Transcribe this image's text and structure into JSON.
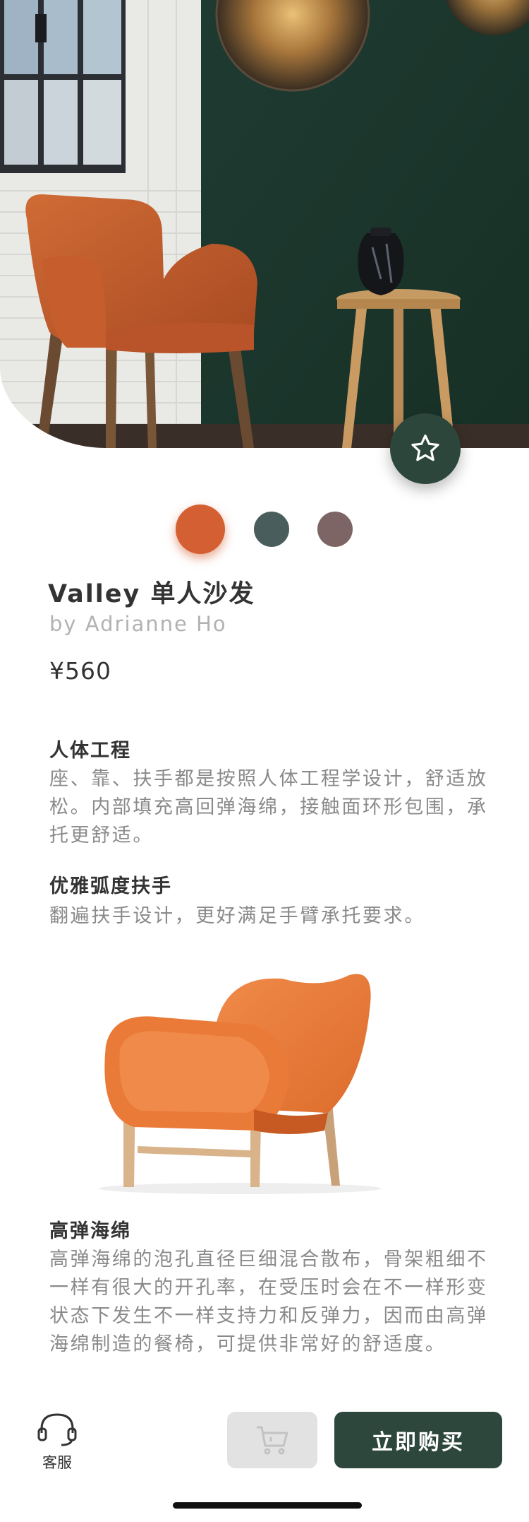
{
  "product": {
    "title": "Valley 单人沙发",
    "author": "by Adrianne Ho",
    "price": "¥560"
  },
  "colors": {
    "options": [
      "#d45f32",
      "#4a5d5d",
      "#7d6565"
    ],
    "selected_index": 0,
    "accent": "#2c463c"
  },
  "features": [
    {
      "title": "人体工程",
      "text": "座、靠、扶手都是按照人体工程学设计，舒适放松。内部填充高回弹海绵，接触面环形包围，承托更舒适。"
    },
    {
      "title": "优雅弧度扶手",
      "text": "翻遍扶手设计，更好满足手臂承托要求。"
    },
    {
      "title": "高弹海绵",
      "text": "高弹海绵的泡孔直径巨细混合散布，骨架粗细不一样有很大的开孔率，在受压时会在不一样形变状态下发生不一样支持力和反弹力，因而由高弹海绵制造的餐椅，可提供非常好的舒适度。"
    }
  ],
  "icons": {
    "favorite": "star-outline-icon",
    "service": "headset-icon",
    "cart": "cart-icon"
  },
  "bottom_bar": {
    "service_label": "客服",
    "buy_label": "立即购买"
  }
}
